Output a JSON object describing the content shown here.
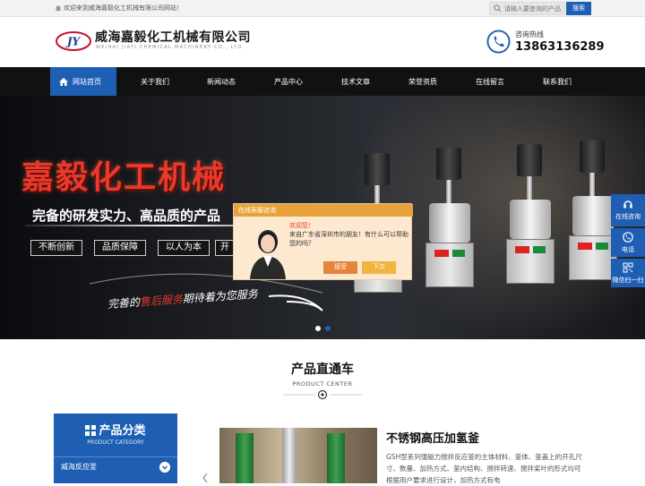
{
  "topbar": {
    "welcome": "欢迎来到威海嘉毅化工机械有限公司网站！",
    "search_placeholder": "请输入要查询的产品",
    "search_button": "搜索"
  },
  "header": {
    "logo_text": "JY",
    "company_name": "威海嘉毅化工机械有限公司",
    "company_name_en": "WEIHAI JIAYI CHEMICAL MACHINERY CO., LTD",
    "hotline_label": "咨询热线",
    "hotline_number": "13863136289"
  },
  "nav": {
    "items": [
      "网站首页",
      "关于我们",
      "新闻动态",
      "产品中心",
      "技术文章",
      "荣誉资质",
      "在线留言",
      "联系我们"
    ]
  },
  "banner": {
    "title": "嘉毅化工机械",
    "subtitle": "完备的研发实力、高品质的产品",
    "pills": [
      "不断创新",
      "品质保障",
      "以人为本",
      "开"
    ],
    "service_pre": "完善的",
    "service_red": "售后服务",
    "service_post": "期待着为您服务"
  },
  "popup": {
    "header": "在线客服咨询",
    "greeting": "欢迎您！",
    "message": "来自广东省深圳市的朋友！有什么可以帮助您的吗？",
    "accept": "接受",
    "later": "下次"
  },
  "side": {
    "consult": "在线咨询",
    "phone": "电话",
    "wechat": "微信扫一扫"
  },
  "section": {
    "title": "产品直通车",
    "subtitle": "PRODUCT CENTER"
  },
  "category": {
    "title": "产品分类",
    "subtitle": "PRODUCT CATEGORY",
    "items": [
      "威海反应釜"
    ]
  },
  "product": {
    "name": "不锈钢高压加氢釜",
    "description": "GSH型系列强磁力搅拌反应釜的主体材料、釜体、釜盖上的开孔尺寸、数量、加热方式、釜内结构、搅拌转速、搅拌桨叶的形式均可根据用户要求进行设计，加热方式有电",
    "image_icon": "product-photo"
  }
}
